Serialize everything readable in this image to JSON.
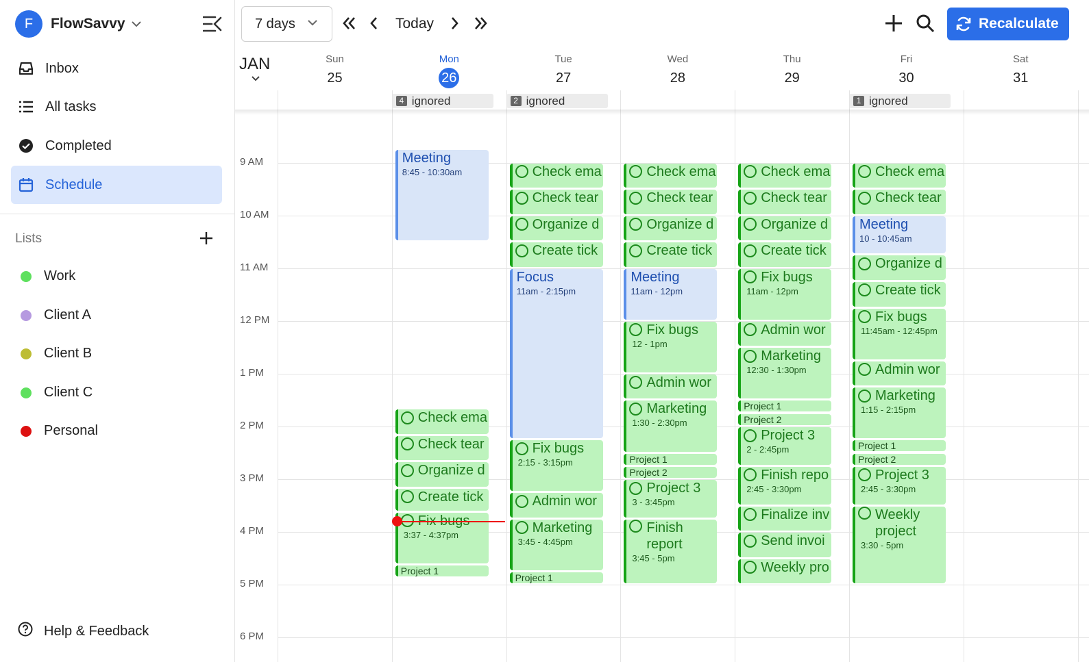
{
  "app": {
    "name": "FlowSavvy",
    "avatar_letter": "F",
    "accent": "#2b6ee8"
  },
  "nav": [
    {
      "label": "Inbox",
      "icon": "inbox-icon"
    },
    {
      "label": "All tasks",
      "icon": "list-icon"
    },
    {
      "label": "Completed",
      "icon": "check-circle-icon"
    },
    {
      "label": "Schedule",
      "icon": "calendar-icon",
      "active": true
    }
  ],
  "lists": {
    "heading": "Lists",
    "items": [
      {
        "label": "Work",
        "color": "#5ee05e"
      },
      {
        "label": "Client A",
        "color": "#b69ae0"
      },
      {
        "label": "Client B",
        "color": "#bdbd33"
      },
      {
        "label": "Client C",
        "color": "#5ee05e"
      },
      {
        "label": "Personal",
        "color": "#dd1111"
      }
    ]
  },
  "help": {
    "label": "Help & Feedback"
  },
  "toolbar": {
    "range": "7 days",
    "today": "Today",
    "recalculate": "Recalculate"
  },
  "calendar": {
    "month": "JAN",
    "days": [
      {
        "name": "Sun",
        "date": "25"
      },
      {
        "name": "Mon",
        "date": "26",
        "today": true
      },
      {
        "name": "Tue",
        "date": "27"
      },
      {
        "name": "Wed",
        "date": "28"
      },
      {
        "name": "Thu",
        "date": "29"
      },
      {
        "name": "Fri",
        "date": "30"
      },
      {
        "name": "Sat",
        "date": "31"
      }
    ],
    "ignored": [
      {
        "day": 1,
        "count": "4",
        "label": "ignored"
      },
      {
        "day": 2,
        "count": "2",
        "label": "ignored"
      },
      {
        "day": 5,
        "count": "1",
        "label": "ignored"
      }
    ],
    "hours": [
      "9 AM",
      "10 AM",
      "11 AM",
      "12 PM",
      "1 PM",
      "2 PM",
      "3 PM",
      "4 PM",
      "5 PM",
      "6 PM"
    ],
    "events": [
      {
        "day": 1,
        "kind": "meet",
        "title": "Meeting",
        "time": "8:45 - 10:30am",
        "start": 8.75,
        "end": 10.5
      },
      {
        "day": 1,
        "kind": "task",
        "title": "Check ema",
        "start": 13.667,
        "end": 14.167
      },
      {
        "day": 1,
        "kind": "task",
        "title": "Check tear",
        "start": 14.167,
        "end": 14.667
      },
      {
        "day": 1,
        "kind": "task",
        "title": "Organize d",
        "start": 14.667,
        "end": 15.167
      },
      {
        "day": 1,
        "kind": "task",
        "title": "Create tick",
        "start": 15.167,
        "end": 15.617
      },
      {
        "day": 1,
        "kind": "task",
        "title": "Fix bugs",
        "time": "3:37 - 4:37pm",
        "start": 15.617,
        "end": 16.617
      },
      {
        "day": 1,
        "kind": "small",
        "title": "Project 1",
        "start": 16.617,
        "end": 16.85
      },
      {
        "day": 2,
        "kind": "task",
        "title": "Check ema",
        "start": 9,
        "end": 9.5
      },
      {
        "day": 2,
        "kind": "task",
        "title": "Check tear",
        "start": 9.5,
        "end": 10
      },
      {
        "day": 2,
        "kind": "task",
        "title": "Organize d",
        "start": 10,
        "end": 10.5
      },
      {
        "day": 2,
        "kind": "task",
        "title": "Create tick",
        "start": 10.5,
        "end": 11
      },
      {
        "day": 2,
        "kind": "meet",
        "title": "Focus",
        "time": "11am - 2:15pm",
        "start": 11,
        "end": 14.25
      },
      {
        "day": 2,
        "kind": "task",
        "title": "Fix bugs",
        "time": "2:15 - 3:15pm",
        "start": 14.25,
        "end": 15.25
      },
      {
        "day": 2,
        "kind": "task",
        "title": "Admin wor",
        "start": 15.25,
        "end": 15.75
      },
      {
        "day": 2,
        "kind": "task",
        "title": "Marketing",
        "time": "3:45 - 4:45pm",
        "start": 15.75,
        "end": 16.75
      },
      {
        "day": 2,
        "kind": "small",
        "title": "Project 1",
        "start": 16.75,
        "end": 16.98
      },
      {
        "day": 3,
        "kind": "task",
        "title": "Check ema",
        "start": 9,
        "end": 9.5
      },
      {
        "day": 3,
        "kind": "task",
        "title": "Check tear",
        "start": 9.5,
        "end": 10
      },
      {
        "day": 3,
        "kind": "task",
        "title": "Organize d",
        "start": 10,
        "end": 10.5
      },
      {
        "day": 3,
        "kind": "task",
        "title": "Create tick",
        "start": 10.5,
        "end": 11
      },
      {
        "day": 3,
        "kind": "meet",
        "title": "Meeting",
        "time": "11am - 12pm",
        "start": 11,
        "end": 12
      },
      {
        "day": 3,
        "kind": "task",
        "title": "Fix bugs",
        "time": "12 - 1pm",
        "start": 12,
        "end": 13
      },
      {
        "day": 3,
        "kind": "task",
        "title": "Admin wor",
        "start": 13,
        "end": 13.5
      },
      {
        "day": 3,
        "kind": "task",
        "title": "Marketing",
        "time": "1:30 - 2:30pm",
        "start": 13.5,
        "end": 14.5
      },
      {
        "day": 3,
        "kind": "small",
        "title": "Project 1",
        "start": 14.5,
        "end": 14.75
      },
      {
        "day": 3,
        "kind": "small",
        "title": "Project 2",
        "start": 14.75,
        "end": 15
      },
      {
        "day": 3,
        "kind": "task",
        "title": "Project 3",
        "time": "3 - 3:45pm",
        "start": 15,
        "end": 15.75
      },
      {
        "day": 3,
        "kind": "task",
        "title": "Finish report",
        "time": "3:45 - 5pm",
        "start": 15.75,
        "end": 17,
        "wrap": true
      },
      {
        "day": 4,
        "kind": "task",
        "title": "Check ema",
        "start": 9,
        "end": 9.5
      },
      {
        "day": 4,
        "kind": "task",
        "title": "Check tear",
        "start": 9.5,
        "end": 10
      },
      {
        "day": 4,
        "kind": "task",
        "title": "Organize d",
        "start": 10,
        "end": 10.5
      },
      {
        "day": 4,
        "kind": "task",
        "title": "Create tick",
        "start": 10.5,
        "end": 11
      },
      {
        "day": 4,
        "kind": "task",
        "title": "Fix bugs",
        "time": "11am - 12pm",
        "start": 11,
        "end": 12
      },
      {
        "day": 4,
        "kind": "task",
        "title": "Admin wor",
        "start": 12,
        "end": 12.5
      },
      {
        "day": 4,
        "kind": "task",
        "title": "Marketing",
        "time": "12:30 - 1:30pm",
        "start": 12.5,
        "end": 13.5
      },
      {
        "day": 4,
        "kind": "small",
        "title": "Project 1",
        "start": 13.5,
        "end": 13.75
      },
      {
        "day": 4,
        "kind": "small",
        "title": "Project 2",
        "start": 13.75,
        "end": 14
      },
      {
        "day": 4,
        "kind": "task",
        "title": "Project 3",
        "time": "2 - 2:45pm",
        "start": 14,
        "end": 14.75
      },
      {
        "day": 4,
        "kind": "task",
        "title": "Finish repo",
        "time": "2:45 - 3:30pm",
        "start": 14.75,
        "end": 15.5
      },
      {
        "day": 4,
        "kind": "task",
        "title": "Finalize inv",
        "start": 15.5,
        "end": 16
      },
      {
        "day": 4,
        "kind": "task",
        "title": "Send invoi",
        "start": 16,
        "end": 16.5
      },
      {
        "day": 4,
        "kind": "task",
        "title": "Weekly pro",
        "start": 16.5,
        "end": 17
      },
      {
        "day": 5,
        "kind": "task",
        "title": "Check ema",
        "start": 9,
        "end": 9.5
      },
      {
        "day": 5,
        "kind": "task",
        "title": "Check tear",
        "start": 9.5,
        "end": 10
      },
      {
        "day": 5,
        "kind": "meet",
        "title": "Meeting",
        "time": "10 - 10:45am",
        "start": 10,
        "end": 10.75
      },
      {
        "day": 5,
        "kind": "task",
        "title": "Organize d",
        "start": 10.75,
        "end": 11.25
      },
      {
        "day": 5,
        "kind": "task",
        "title": "Create tick",
        "start": 11.25,
        "end": 11.75
      },
      {
        "day": 5,
        "kind": "task",
        "title": "Fix bugs",
        "time": "11:45am - 12:45pm",
        "start": 11.75,
        "end": 12.75
      },
      {
        "day": 5,
        "kind": "task",
        "title": "Admin wor",
        "start": 12.75,
        "end": 13.25
      },
      {
        "day": 5,
        "kind": "task",
        "title": "Marketing",
        "time": "1:15 - 2:15pm",
        "start": 13.25,
        "end": 14.25
      },
      {
        "day": 5,
        "kind": "small",
        "title": "Project 1",
        "start": 14.25,
        "end": 14.5
      },
      {
        "day": 5,
        "kind": "small",
        "title": "Project 2",
        "start": 14.5,
        "end": 14.75
      },
      {
        "day": 5,
        "kind": "task",
        "title": "Project 3",
        "time": "2:45 - 3:30pm",
        "start": 14.75,
        "end": 15.5
      },
      {
        "day": 5,
        "kind": "task",
        "title": "Weekly project",
        "time": "3:30 - 5pm",
        "start": 15.5,
        "end": 17,
        "wrap": true
      }
    ]
  }
}
